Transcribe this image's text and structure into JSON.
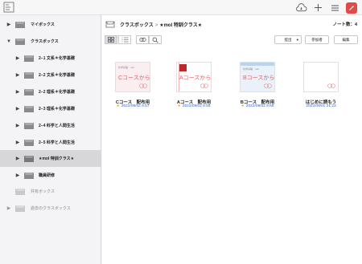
{
  "topbar": {
    "icons": [
      "app-logo-icon",
      "cloud-sync-icon",
      "plus-icon",
      "menu-icon",
      "edit-icon"
    ]
  },
  "sidebar": {
    "items": [
      {
        "label": "マイボックス",
        "expand": "collapsed"
      },
      {
        "label": "クラスボックス",
        "expand": "expanded"
      },
      {
        "label": "2−1 文系＊化学基礎",
        "expand": "collapsed"
      },
      {
        "label": "2−2 文系＊化学基礎",
        "expand": "collapsed"
      },
      {
        "label": "2−2 理系＊化学基礎",
        "expand": "collapsed"
      },
      {
        "label": "2−3 理系＊化学基礎",
        "expand": "collapsed"
      },
      {
        "label": "2−4 科学と人間生活",
        "expand": "collapsed"
      },
      {
        "label": "2−5 科学と人間生活",
        "expand": "collapsed"
      },
      {
        "label": "★mol 特訓クラス★",
        "expand": "collapsed",
        "selected": true
      },
      {
        "label": "職員研修",
        "expand": "collapsed"
      },
      {
        "label": "共有ボックス",
        "expand": "none",
        "muted": true
      },
      {
        "label": "過去のクラスボックス",
        "expand": "collapsed",
        "muted": true
      }
    ]
  },
  "header": {
    "crumb_root": "クラスボックス",
    "crumb_sep": ">",
    "crumb_current": "★mol 特訓クラス★",
    "note_count": "ノート数：4"
  },
  "toolbar": {
    "sort_label": "提出",
    "sort_caret": "▾",
    "participants_label": "参加者",
    "edit_label": "編集"
  },
  "notes": [
    {
      "title": "Cコース　配布用",
      "date": "2022/09/02 9:57",
      "starred": true,
      "thumb_text": "Cコースから",
      "thumb_header": "化学基礎　mol",
      "accent": "#f7dce2"
    },
    {
      "title": "Aコース　配布用",
      "date": "2022/09/02 9:56",
      "starred": true,
      "thumb_text": "Aコースから",
      "thumb_header": "化学基礎　mol",
      "accent": "#c0272d"
    },
    {
      "title": "Bコース　配布用",
      "date": "2022/09/02 9:56",
      "starred": true,
      "thumb_text": "Bコースから",
      "thumb_header": "化学基礎　mol",
      "accent": "#b9d3f3"
    },
    {
      "title": "はじめに読もう",
      "date": "2022/09/01 21:23",
      "starred": false,
      "thumb_text": "",
      "thumb_header": "",
      "accent": "#ffffff"
    }
  ],
  "colors": {
    "selected_bg": "#d7d7da",
    "date_text": "#3a6ab8",
    "star": "#e5b32b",
    "edit_button": "#e04a4a"
  }
}
